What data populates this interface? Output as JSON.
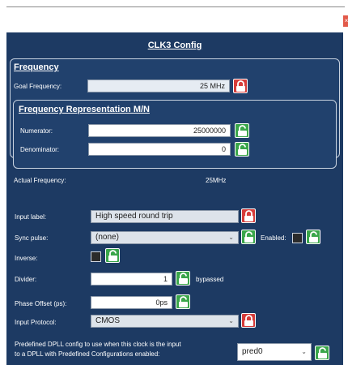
{
  "window": {
    "close_label": "×"
  },
  "panel": {
    "title": "CLK3 Config"
  },
  "frequency": {
    "section_title": "Frequency",
    "goal_label": "Goal Frequency:",
    "goal_value": "25 MHz",
    "rep_title": "Frequency Representation M/N",
    "numerator_label": "Numerator:",
    "numerator_value": "25000000",
    "denominator_label": "Denominator:",
    "denominator_value": "0",
    "actual_label": "Actual Frequency:",
    "actual_value": "25MHz"
  },
  "settings": {
    "input_label_label": "Input label:",
    "input_label_value": "High speed round trip",
    "sync_pulse_label": "Sync pulse:",
    "sync_pulse_value": "(none)",
    "enabled_label": "Enabled:",
    "inverse_label": "Inverse:",
    "divider_label": "Divider:",
    "divider_value": "1",
    "bypassed_label": "bypassed",
    "phase_offset_label": "Phase Offset (ps):",
    "phase_offset_value": "0ps",
    "input_protocol_label": "Input Protocol:",
    "input_protocol_value": "CMOS",
    "predefined_label_line1": "Predefined DPLL config to use when this clock is the input",
    "predefined_label_line2": "to a DPLL with Predefined Configurations enabled:",
    "predefined_value": "pred0"
  },
  "colors": {
    "panel_bg": "#1d3a63",
    "lock_locked": "#d63c3a",
    "lock_unlocked": "#3aa64a"
  },
  "icons": {
    "locked": "lock-closed-icon",
    "unlocked": "lock-open-icon",
    "dropdown": "chevron-down-icon"
  }
}
